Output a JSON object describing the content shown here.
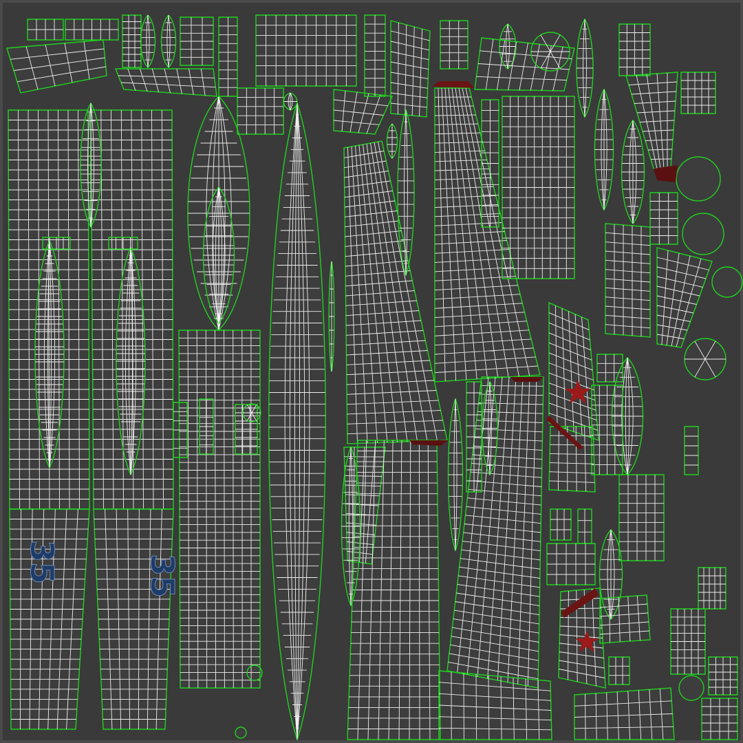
{
  "texture": {
    "background_color": "#3a3a3a",
    "grid_color": "#ffffff",
    "seam_color": "#1fd21f",
    "shadow_color": "#2a2a2a"
  },
  "markings": {
    "number_left": "35",
    "number_right": "35",
    "number_color": "#1f3c68",
    "star_color": "#9c1a1a"
  }
}
